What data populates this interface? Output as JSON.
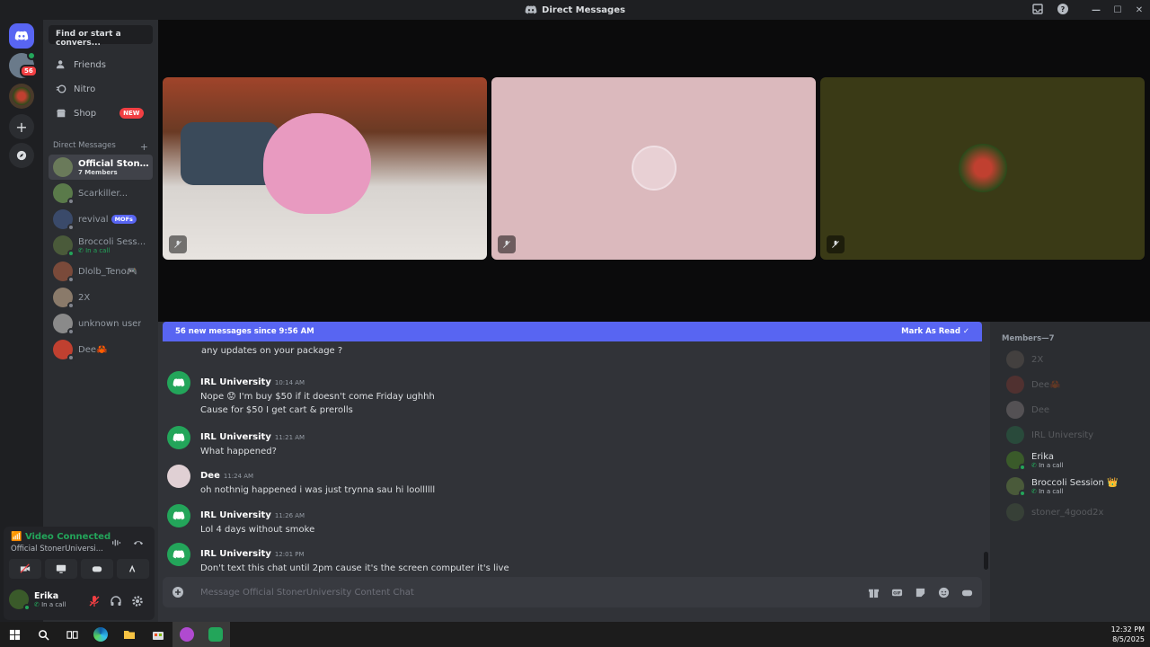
{
  "window": {
    "title": "Direct Messages",
    "controls": [
      "—",
      "☐",
      "✕"
    ]
  },
  "guilds": {
    "home_badge": "56"
  },
  "sidebar": {
    "search_label": "Find or start a convers...",
    "nav": [
      {
        "label": "Friends"
      },
      {
        "label": "Nitro"
      },
      {
        "label": "Shop",
        "badge": "NEW"
      }
    ],
    "dm_header": "Direct Messages",
    "dm_add": "+",
    "dms": [
      {
        "name": "Official Stone...",
        "sub": "7 Members",
        "color": "#6a7a5a"
      },
      {
        "name": "Scarkiller...",
        "sub": "",
        "color": "#5a7a4a"
      },
      {
        "name": "revival",
        "sub": "",
        "tag": "MOFs",
        "color": "#3a4a6a"
      },
      {
        "name": "Broccoli Sess...",
        "sub": "In a call",
        "color": "#4a5a3a"
      },
      {
        "name": "Dlolb_Teno🎮",
        "sub": "",
        "color": "#7a4a3a"
      },
      {
        "name": "2X",
        "sub": "",
        "color": "#8a7a6a"
      },
      {
        "name": "unknown user",
        "sub": "",
        "color": "#8a8a8a"
      },
      {
        "name": "Dee🦀",
        "sub": "",
        "color": "#c04030"
      }
    ]
  },
  "voice": {
    "status": "Video Connected",
    "channel": "Official StonerUniversi..."
  },
  "user": {
    "name": "Erika",
    "sub": "In a call"
  },
  "banner": {
    "text": "56 new messages since 9:56 AM",
    "action": "Mark As Read"
  },
  "messages": {
    "first_cont": "any updates on your package ?",
    "m1": {
      "author": "IRL University",
      "time": "10:14 AM",
      "line1_a": "Nope",
      "line1_emoji": "😟",
      "line1_b": "I'm buy $50 if it doesn't come Friday ughhh",
      "line2": "Cause for $50 I get cart & prerolls"
    },
    "m2": {
      "author": "IRL University",
      "time": "11:21 AM",
      "line1": "What happened?"
    },
    "m3": {
      "author": "Dee",
      "time": "11:24 AM",
      "line1": "oh nothnig happened i was just trynna sau hi loollllll"
    },
    "m4": {
      "author": "IRL University",
      "time": "11:26 AM",
      "line1": "Lol 4 days without smoke"
    },
    "m5": {
      "author": "IRL University",
      "time": "12:01 PM",
      "line1": "Don't text this chat until 2pm cause it's the screen computer it's live"
    }
  },
  "composer": {
    "placeholder": "Message Official StonerUniversity Content Chat"
  },
  "members": {
    "header": "Members—7",
    "list": [
      {
        "name": "2X",
        "sub": "",
        "dim": true,
        "color": "#8a7a6a"
      },
      {
        "name": "Dee🦀",
        "sub": "",
        "dim": true,
        "color": "#c04030"
      },
      {
        "name": "Dee",
        "sub": "",
        "dim": true,
        "color": "#d0c0c0"
      },
      {
        "name": "IRL University",
        "sub": "",
        "dim": true,
        "color": "#23a55a"
      },
      {
        "name": "Erika",
        "sub": "In a call",
        "dim": false,
        "color": "#3a5a2a"
      },
      {
        "name": "Broccoli Session 👑",
        "sub": "In a call",
        "dim": false,
        "color": "#4a5a3a"
      },
      {
        "name": "stoner_4good2x",
        "sub": "",
        "dim": true,
        "color": "#5a7a4a"
      }
    ]
  },
  "clock": {
    "time": "12:32 PM",
    "date": "8/5/2025"
  },
  "colors": {
    "accent": "#5865f2",
    "online_green": "#23a55a",
    "danger": "#f23f43"
  }
}
